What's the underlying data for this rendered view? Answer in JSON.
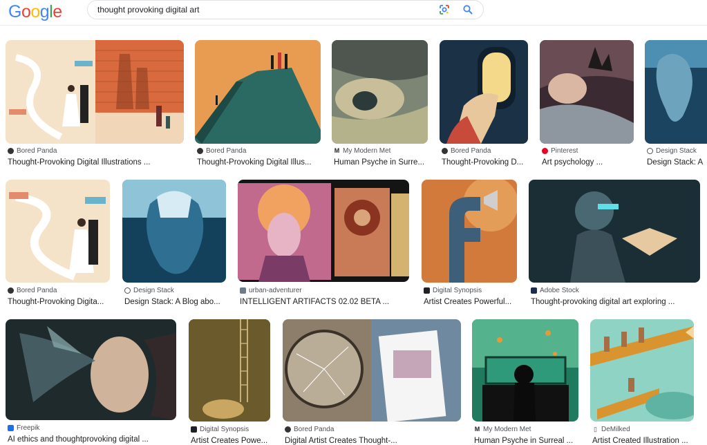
{
  "logo": {
    "letters": [
      "G",
      "o",
      "o",
      "g",
      "l",
      "e"
    ],
    "colors": [
      "#4285F4",
      "#EA4335",
      "#FBBC05",
      "#4285F4",
      "#34A853",
      "#EA4335"
    ]
  },
  "search": {
    "value": "thought provoking digital art",
    "lens_icon": "google-lens-icon",
    "search_icon": "search-icon"
  },
  "results": [
    {
      "source": "Bored Panda",
      "title": "Thought-Provoking Digital Illustrations ...",
      "icon": "bored-panda-icon"
    },
    {
      "source": "Bored Panda",
      "title": "Thought-Provoking Digital Illus...",
      "icon": "bored-panda-icon"
    },
    {
      "source": "My Modern Met",
      "title": "Human Psyche in Surre...",
      "icon": "my-modern-met-icon"
    },
    {
      "source": "Bored Panda",
      "title": "Thought-Provoking D...",
      "icon": "bored-panda-icon"
    },
    {
      "source": "Pinterest",
      "title": "Art psychology ...",
      "icon": "pinterest-icon"
    },
    {
      "source": "Design Stack",
      "title": "Design Stack: A",
      "icon": "design-stack-icon"
    },
    {
      "source": "Bored Panda",
      "title": "Thought-Provoking Digita...",
      "icon": "bored-panda-icon"
    },
    {
      "source": "Design Stack",
      "title": "Design Stack: A Blog abo...",
      "icon": "design-stack-icon"
    },
    {
      "source": "urban-adventurer",
      "title": "INTELLIGENT ARTIFACTS 02.02 BETA ...",
      "icon": "urban-adventurer-icon"
    },
    {
      "source": "Digital Synopsis",
      "title": "Artist Creates Powerful...",
      "icon": "digital-synopsis-icon"
    },
    {
      "source": "Adobe Stock",
      "title": "Thought-provoking digital art exploring ...",
      "icon": "adobe-stock-icon"
    },
    {
      "source": "Freepik",
      "title": "AI ethics and thoughtprovoking digital ...",
      "icon": "freepik-icon"
    },
    {
      "source": "Digital Synopsis",
      "title": "Artist Creates Powe...",
      "icon": "digital-synopsis-icon"
    },
    {
      "source": "Bored Panda",
      "title": "Digital Artist Creates Thought-...",
      "icon": "bored-panda-icon"
    },
    {
      "source": "My Modern Met",
      "title": "Human Psyche in Surreal ...",
      "icon": "my-modern-met-icon"
    },
    {
      "source": "DeMilked",
      "title": "Artist Created Illustration ...",
      "icon": "demilked-icon"
    }
  ]
}
